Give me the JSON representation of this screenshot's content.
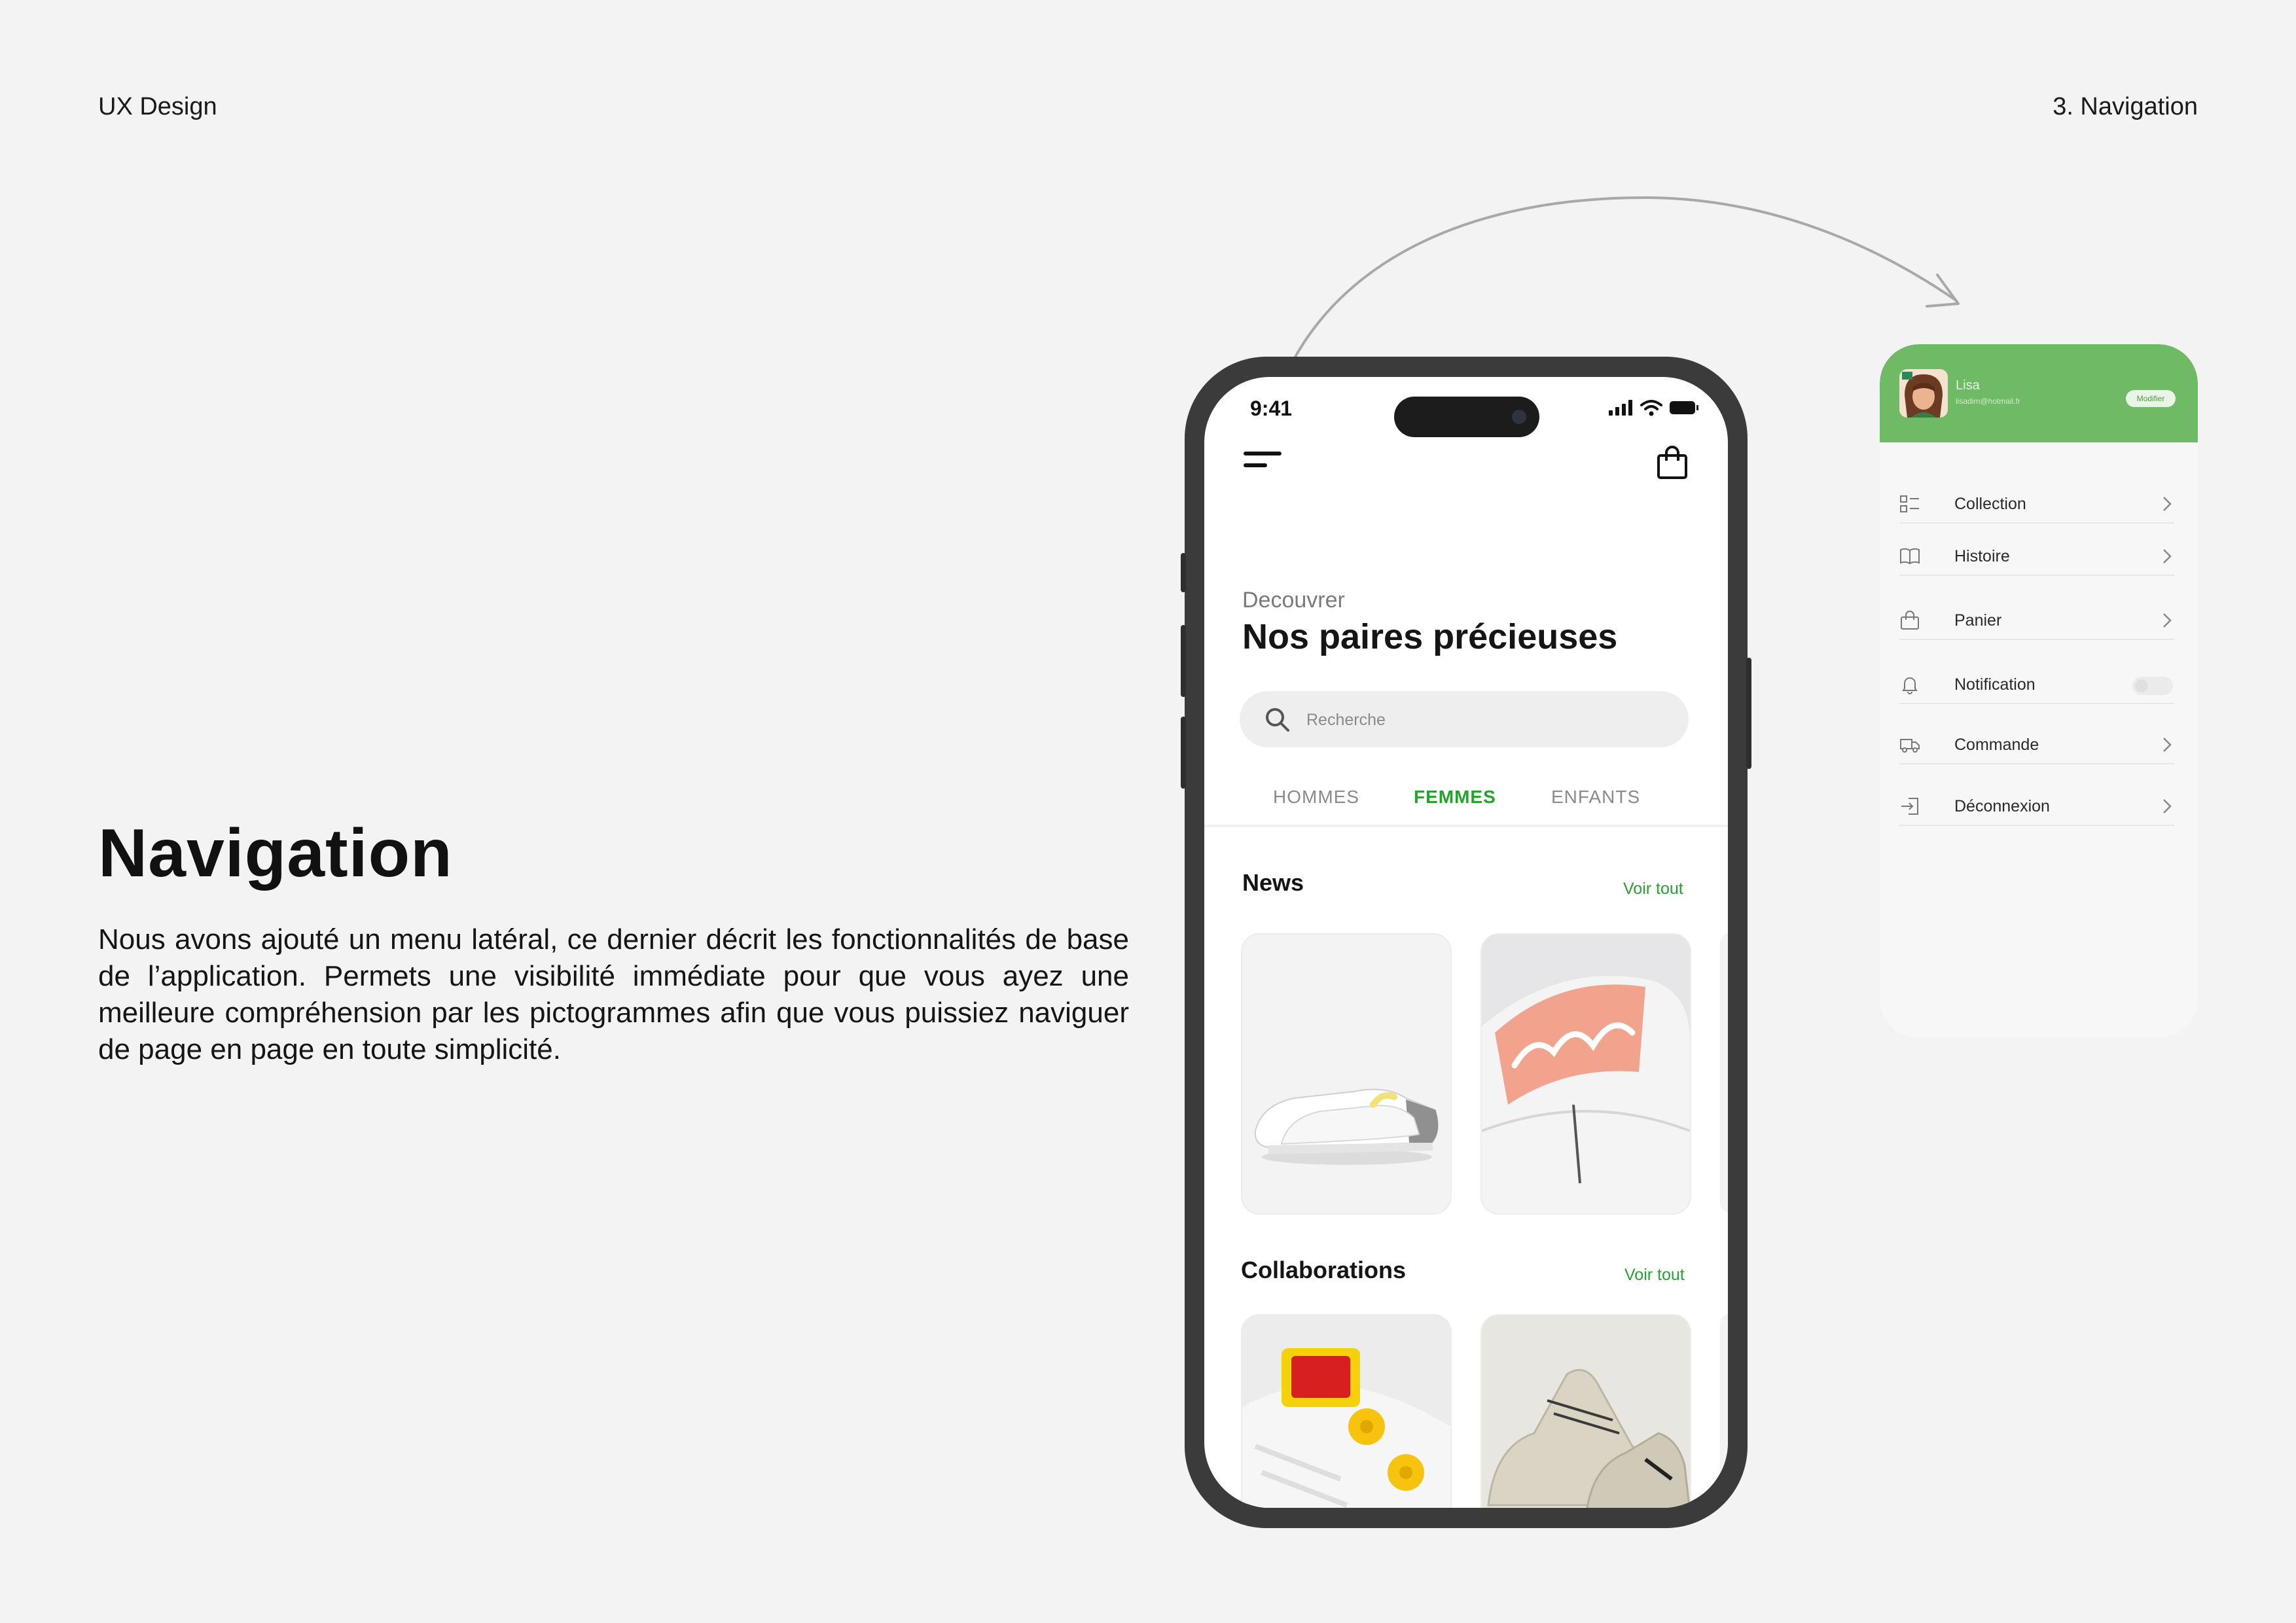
{
  "header": {
    "left": "UX Design",
    "right": "3. Navigation"
  },
  "intro": {
    "title": "Navigation",
    "description": "Nous avons ajouté un menu latéral, ce dernier décrit les fonctionnalités de base de l’application. Permets une visibilité immédiate pour que vous ayez une meilleure compréhension par les pictogrammes afin que vous puissiez naviguer de page en page en toute simplicité."
  },
  "phone": {
    "status_time": "9:41",
    "eyebrow": "Decouvrer",
    "headline": "Nos paires précieuses",
    "search_placeholder": "Recherche",
    "tabs": [
      {
        "label": "HOMMES",
        "active": false
      },
      {
        "label": "FEMMES",
        "active": true
      },
      {
        "label": "ENFANTS",
        "active": false
      }
    ],
    "sections": [
      {
        "title": "News",
        "link": "Voir tout"
      },
      {
        "title": "Collaborations",
        "link": "Voir tout"
      }
    ]
  },
  "side_menu": {
    "user": {
      "name": "Lisa",
      "email": "lisadim@hotmail.fr",
      "edit_label": "Modifier"
    },
    "items": [
      {
        "label": "Collection",
        "icon": "list-icon",
        "control": "chevron"
      },
      {
        "label": "Histoire",
        "icon": "book-icon",
        "control": "chevron"
      },
      {
        "label": "Panier",
        "icon": "bag-icon",
        "control": "chevron"
      },
      {
        "label": "Notification",
        "icon": "bell-icon",
        "control": "toggle",
        "toggle_on": false
      },
      {
        "label": "Commande",
        "icon": "truck-icon",
        "control": "chevron"
      },
      {
        "label": "Déconnexion",
        "icon": "logout-icon",
        "control": "chevron"
      }
    ]
  },
  "colors": {
    "accent_green": "#27a12f",
    "menu_header_green": "#6fba64",
    "background": "#f3f3f3"
  }
}
